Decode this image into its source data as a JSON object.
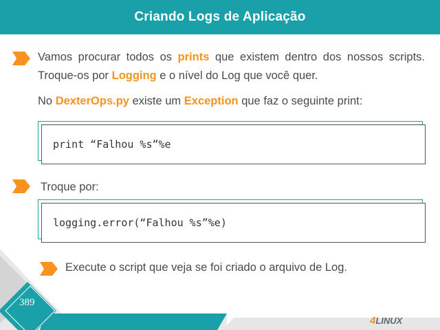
{
  "header": {
    "title": "Criando Logs de Aplicação"
  },
  "bullet1": {
    "t1": "Vamos procurar  todos os ",
    "h1": "prints",
    "t2": " que existem dentro dos nossos scripts. Troque-os por ",
    "h2": "Logging",
    "t3": " e o nível do Log que você quer."
  },
  "line2": {
    "t1": "No ",
    "h1": "DexterOps.py",
    "t2": " existe um ",
    "h2": "Exception",
    "t3": " que faz o seguinte print:"
  },
  "code1": "print “Falhou %s”%e",
  "bullet2": {
    "text": "Troque por:"
  },
  "code2": "logging.error(“Falhou %s”%e)",
  "bullet3": {
    "text": "Execute o script que veja se foi criado o arquivo de Log."
  },
  "footer": {
    "page_number": "389",
    "logo_num": "4",
    "logo_text": "LINUX"
  },
  "colors": {
    "teal": "#1aa0a8",
    "orange": "#f7931e",
    "grey": "#d9d9d9"
  }
}
